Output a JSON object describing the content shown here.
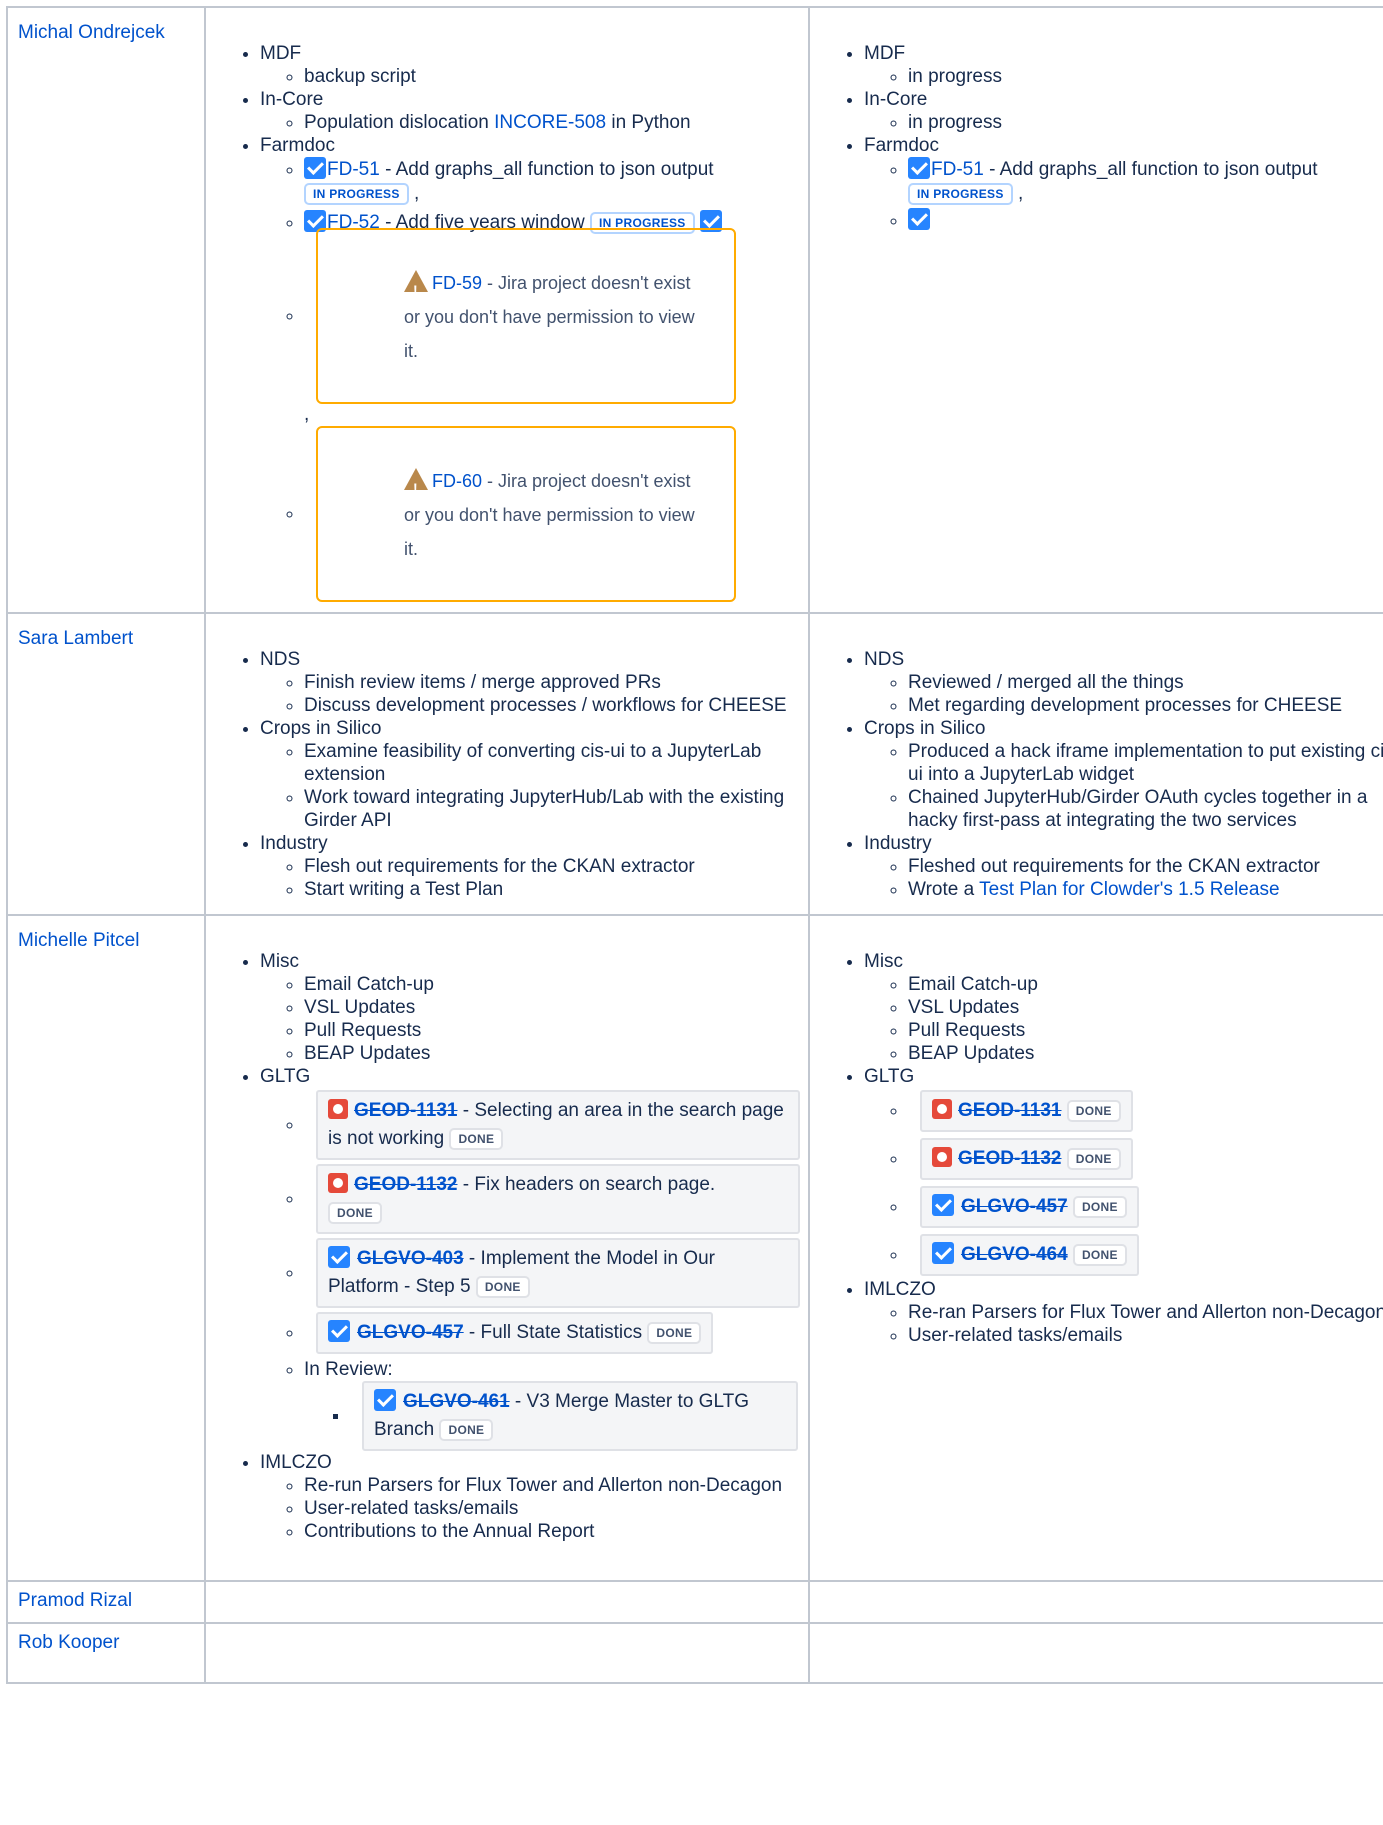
{
  "rows": [
    {
      "name": "Michal Ondrejcek",
      "planned": {
        "mdf": "MDF",
        "mdf_item": "backup script",
        "incore": "In-Core",
        "incore_pre": "Population dislocation ",
        "incore_link": "INCORE-508",
        "incore_post": " in Python",
        "farmdoc": "Farmdoc",
        "fd51_key": "FD-51",
        "fd51_summary": " - Add graphs_all function to json output",
        "fd51_status": "IN PROGRESS",
        "comma": ",",
        "fd52_key": "FD-52",
        "fd52_summary": " - Add five years window",
        "fd52_status": "IN PROGRESS",
        "fd59_key": "FD-59",
        "fd59_msg": " - Jira project doesn't exist or you don't have permission to view it.",
        "fd60_key": "FD-60",
        "fd60_msg": " - Jira project doesn't exist or you don't have permission to view it."
      },
      "done": {
        "mdf": "MDF",
        "mdf_item": "in progress",
        "incore": "In-Core",
        "incore_item": "in progress",
        "farmdoc": "Farmdoc",
        "fd51_key": "FD-51",
        "fd51_summary": " - Add graphs_all function to json output",
        "fd51_status": "IN PROGRESS",
        "comma": ","
      }
    },
    {
      "name": "Sara Lambert",
      "planned": {
        "nds": "NDS",
        "nds_1": "Finish review items / merge approved PRs",
        "nds_2": "Discuss development processes / workflows for CHEESE",
        "crops": "Crops in Silico",
        "crops_1": "Examine feasibility of converting cis-ui to a JupyterLab extension",
        "crops_2": "Work toward integrating JupyterHub/Lab with the existing Girder API",
        "industry": "Industry",
        "industry_1": "Flesh out requirements for the CKAN extractor",
        "industry_2": "Start writing a Test Plan"
      },
      "done": {
        "nds": "NDS",
        "nds_1": "Reviewed / merged all the things",
        "nds_2": "Met regarding development processes for CHEESE",
        "crops": "Crops in Silico",
        "crops_1": "Produced a hack iframe implementation to put existing cis-ui into a JupyterLab widget",
        "crops_2": "Chained JupyterHub/Girder OAuth cycles together in a hacky first-pass at integrating the two services",
        "industry": "Industry",
        "industry_1": "Fleshed out requirements for the CKAN extractor",
        "industry_2_pre": "Wrote a ",
        "industry_2_link": "Test Plan for Clowder's 1.5 Release"
      }
    },
    {
      "name": "Michelle Pitcel",
      "planned": {
        "misc": "Misc",
        "misc_1": "Email Catch-up",
        "misc_2": "VSL Updates",
        "misc_3": "Pull Requests",
        "misc_4": "BEAP Updates",
        "gltg": "GLTG",
        "t1_key": "GEOD-1131",
        "t1_summary": " - Selecting an area in the search page is not working",
        "t2_key": "GEOD-1132",
        "t2_summary": " - Fix headers on search page.",
        "t3_key": "GLGVO-403",
        "t3_summary": " - Implement the Model in Our Platform - Step 5",
        "t4_key": "GLGVO-457",
        "t4_summary": " - Full State Statistics",
        "in_review": "In Review:",
        "t5_key": "GLGVO-461",
        "t5_summary": " - V3 Merge Master to GLTG Branch",
        "status_done": "DONE",
        "imlczo": "IMLCZO",
        "im_1": "Re-run Parsers for Flux Tower and Allerton non-Decagon",
        "im_2": "User-related tasks/emails",
        "im_3": "Contributions to the Annual Report"
      },
      "done": {
        "misc": "Misc",
        "misc_1": "Email Catch-up",
        "misc_2": "VSL Updates",
        "misc_3": "Pull Requests",
        "misc_4": "BEAP Updates",
        "gltg": "GLTG",
        "t1_key": "GEOD-1131",
        "t2_key": "GEOD-1132",
        "t3_key": "GLGVO-457",
        "t4_key": "GLGVO-464",
        "status_done": "DONE",
        "imlczo": "IMLCZO",
        "im_1": "Re-ran Parsers for Flux Tower and Allerton non-Decagon",
        "im_2": "User-related tasks/emails"
      }
    },
    {
      "name": "Pramod Rizal"
    },
    {
      "name": "Rob Kooper"
    }
  ]
}
